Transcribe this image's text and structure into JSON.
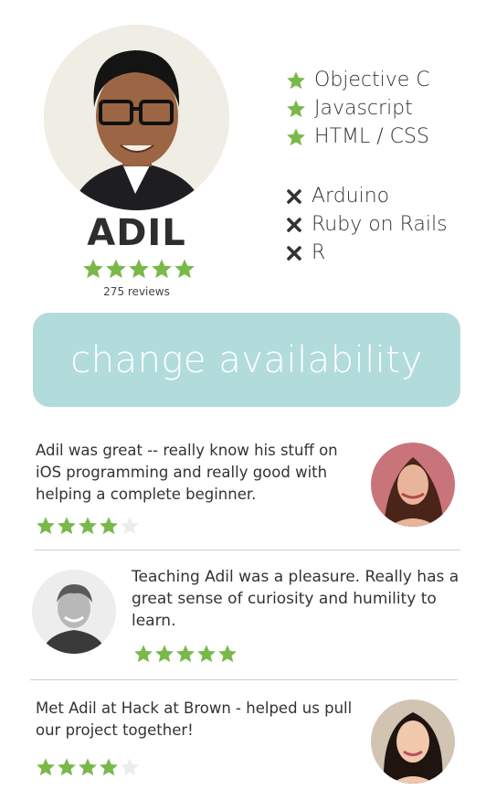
{
  "profile": {
    "name": "ADIL",
    "rating": 5,
    "reviews_label": "275 reviews"
  },
  "skills": {
    "known": [
      "Objective C",
      "Javascript",
      "HTML / CSS"
    ],
    "wanted": [
      "Arduino",
      "Ruby on Rails",
      "R"
    ]
  },
  "availability_button": {
    "label": "change availability"
  },
  "reviews": [
    {
      "text": "Adil was great -- really know his stuff on iOS programming and really good with helping a complete beginner.",
      "rating": 4
    },
    {
      "text": "Teaching Adil was a pleasure. Really has a great sense of curiosity and humility to learn.",
      "rating": 5
    },
    {
      "text": "Met Adil at Hack at Brown - helped us pull our project together!",
      "rating": 4
    }
  ],
  "colors": {
    "star_filled": "#78b94a",
    "star_empty": "#ececec",
    "button_bg": "#b2dcdc",
    "divider": "#cfcfcf"
  },
  "icons": {
    "known_skill": "star-icon",
    "wanted_skill": "x-mark-icon"
  }
}
